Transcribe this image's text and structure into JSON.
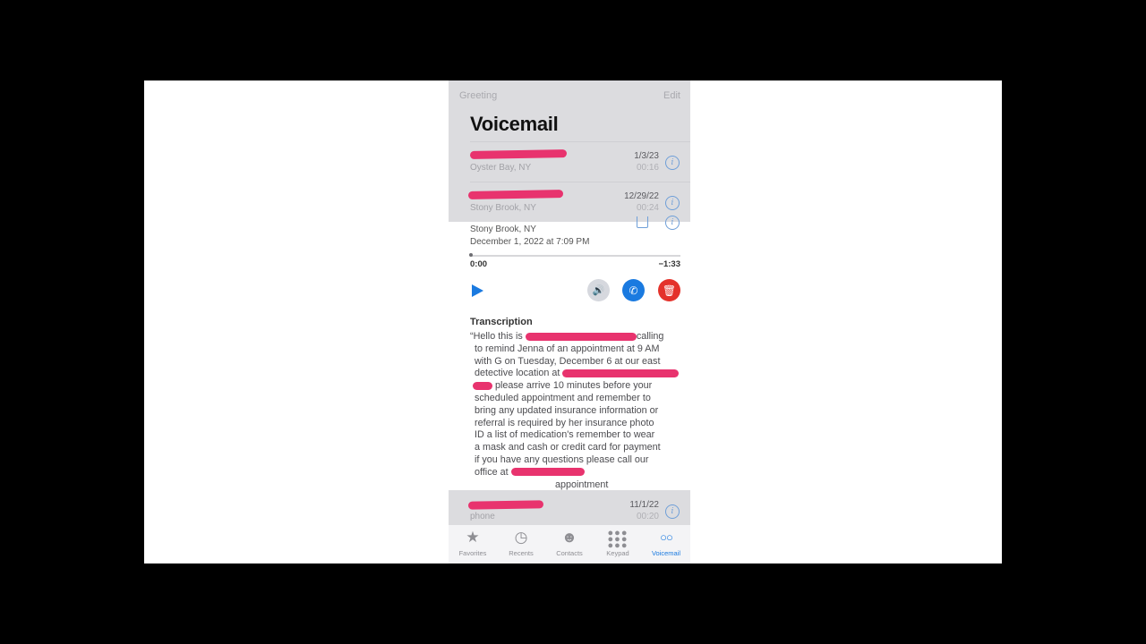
{
  "header": {
    "greeting_label": "Greeting",
    "edit_label": "Edit",
    "title": "Voicemail"
  },
  "voicemails": [
    {
      "location": "Oyster Bay, NY",
      "date": "1/3/23",
      "duration": "00:16"
    },
    {
      "location": "Stony Brook, NY",
      "date": "12/29/22",
      "duration": "00:24"
    }
  ],
  "expanded": {
    "location": "Stony Brook, NY",
    "datetime": "December 1, 2022 at 7:09 PM",
    "elapsed": "0:00",
    "remaining": "−1:33",
    "progress": 0.0,
    "transcription_label": "Transcription",
    "transcription_lines": [
      "“Hello this is",
      "calling",
      "to remind Jenna of an appointment at 9 AM",
      "with G on Tuesday, December 6 at our east",
      "detective location at",
      "please arrive 10 minutes before your",
      "scheduled appointment and remember to",
      "bring any updated insurance information or",
      "referral is required by her insurance photo",
      "ID a list of medication's remember to wear",
      "a mask and cash or credit card for payment",
      "if you have any questions please call our",
      "office at",
      "appointment"
    ]
  },
  "last_voicemail": {
    "subtitle": "phone",
    "date": "11/1/22",
    "duration": "00:20"
  },
  "tabs": [
    {
      "label": "Favorites",
      "icon": "star-icon"
    },
    {
      "label": "Recents",
      "icon": "clock-icon"
    },
    {
      "label": "Contacts",
      "icon": "person-icon"
    },
    {
      "label": "Keypad",
      "icon": "keypad-icon"
    },
    {
      "label": "Voicemail",
      "icon": "voicemail-icon",
      "active": true
    }
  ],
  "colors": {
    "accent": "#1a7ae0",
    "delete": "#e4322b",
    "redaction": "#e8336e"
  }
}
